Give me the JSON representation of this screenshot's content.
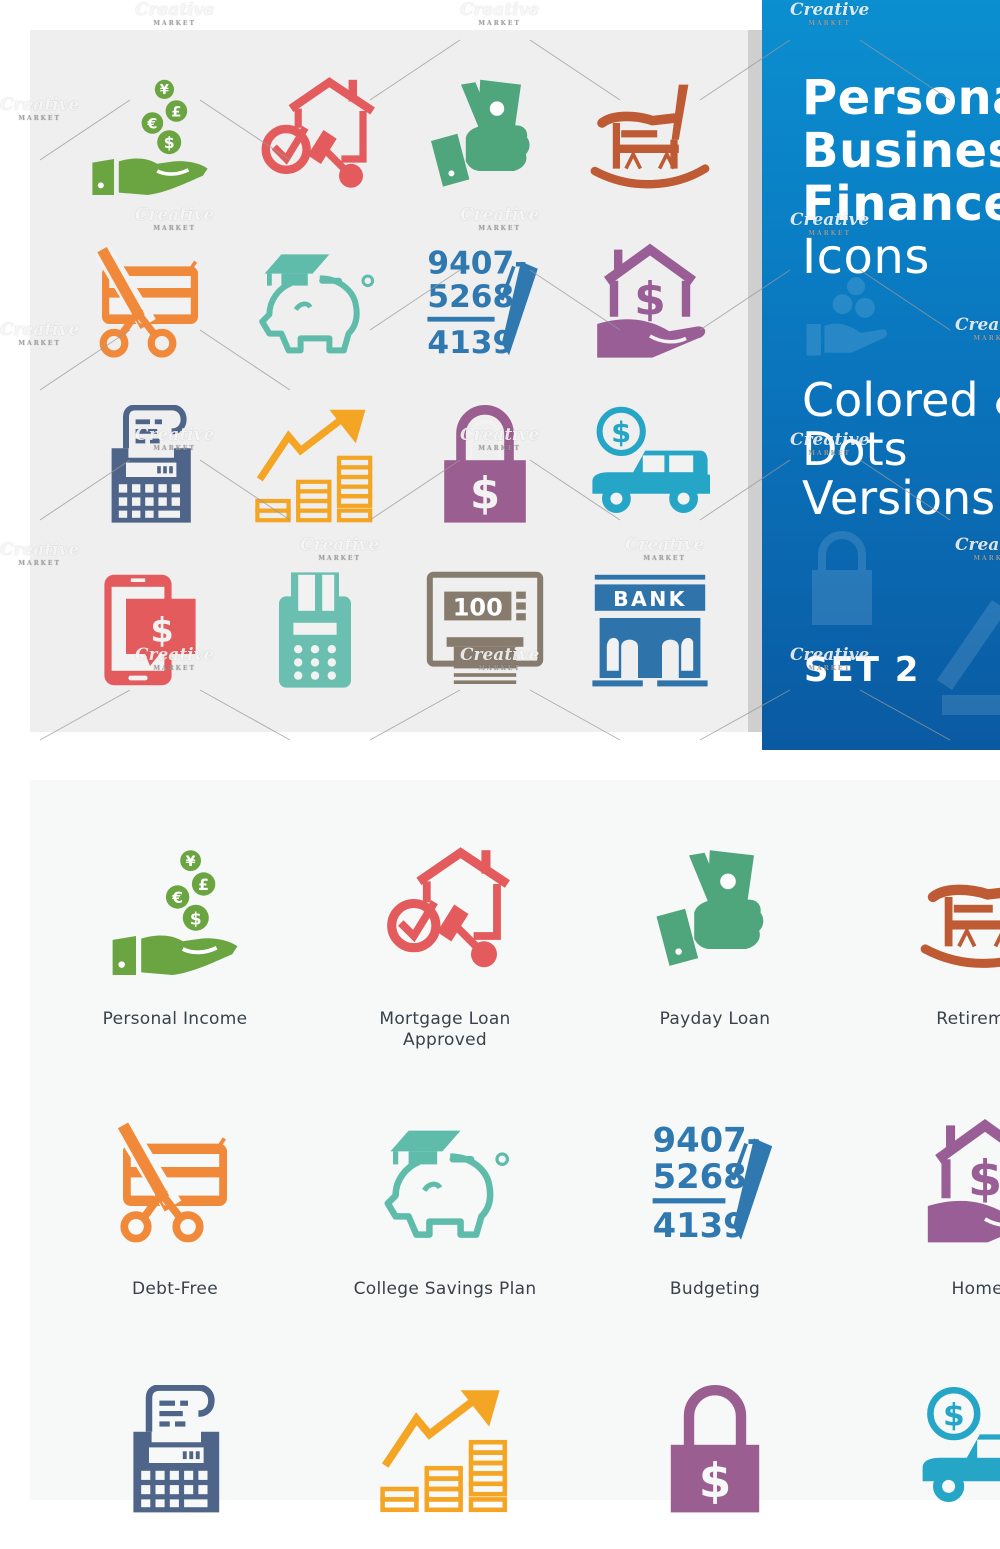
{
  "promo": {
    "title_lines": [
      "Personal",
      "Business",
      "Finance"
    ],
    "title_suffix": "Icons",
    "subtitle_lines": [
      "Colored &",
      "Dots",
      "Versions"
    ],
    "set_label": "SET 2",
    "panel_color": "#0a77bf"
  },
  "watermark": {
    "brand": "Creative",
    "brand_sub": "MARKET"
  },
  "preview_icons": [
    {
      "name": "personal-income",
      "color": "#6aa542"
    },
    {
      "name": "mortgage-loan-approved",
      "color": "#e35b5d"
    },
    {
      "name": "payday-loan",
      "color": "#4fa57c"
    },
    {
      "name": "retirement",
      "color": "#bf5b34"
    },
    {
      "name": "debt-free",
      "color": "#f08a3a"
    },
    {
      "name": "college-savings-plan",
      "color": "#5fbcaa"
    },
    {
      "name": "budgeting",
      "color": "#2f78b0"
    },
    {
      "name": "home-loan",
      "color": "#985e95"
    },
    {
      "name": "cash-register",
      "color": "#4e6489"
    },
    {
      "name": "growth-coins",
      "color": "#f4a523"
    },
    {
      "name": "secure-money",
      "color": "#9a5e90"
    },
    {
      "name": "car-loan",
      "color": "#25a6c6"
    },
    {
      "name": "mobile-payment",
      "color": "#e35b5d"
    },
    {
      "name": "card-terminal",
      "color": "#6bbfb0"
    },
    {
      "name": "atm",
      "color": "#867b6d"
    },
    {
      "name": "bank",
      "color": "#2e73aa"
    }
  ],
  "preview_text": {
    "budget_numbers": [
      "9407-",
      "5268",
      "4139"
    ],
    "atm_amount": "100",
    "bank_sign": "BANK",
    "currency": {
      "yen": "¥",
      "pound": "£",
      "euro": "€",
      "dollar": "$"
    }
  },
  "labeled_icons": [
    {
      "label": "Personal Income",
      "color": "#6aa542",
      "icon": "personal-income"
    },
    {
      "label": "Mortgage Loan Approved",
      "color": "#e35b5d",
      "icon": "mortgage-loan-approved"
    },
    {
      "label": "Payday Loan",
      "color": "#4fa57c",
      "icon": "payday-loan"
    },
    {
      "label": "Retirement",
      "color": "#bf5b34",
      "icon": "retirement"
    },
    {
      "label": "Debt-Free",
      "color": "#f08a3a",
      "icon": "debt-free"
    },
    {
      "label": "College Savings Plan",
      "color": "#5fbcaa",
      "icon": "college-savings-plan"
    },
    {
      "label": "Budgeting",
      "color": "#2f78b0",
      "icon": "budgeting"
    },
    {
      "label": "Home L",
      "color": "#985e95",
      "icon": "home-loan"
    },
    {
      "label": "",
      "color": "#4e6489",
      "icon": "cash-register"
    },
    {
      "label": "",
      "color": "#f4a523",
      "icon": "growth-coins"
    },
    {
      "label": "",
      "color": "#9a5e90",
      "icon": "secure-money"
    },
    {
      "label": "",
      "color": "#25a6c6",
      "icon": "car-loan"
    }
  ]
}
